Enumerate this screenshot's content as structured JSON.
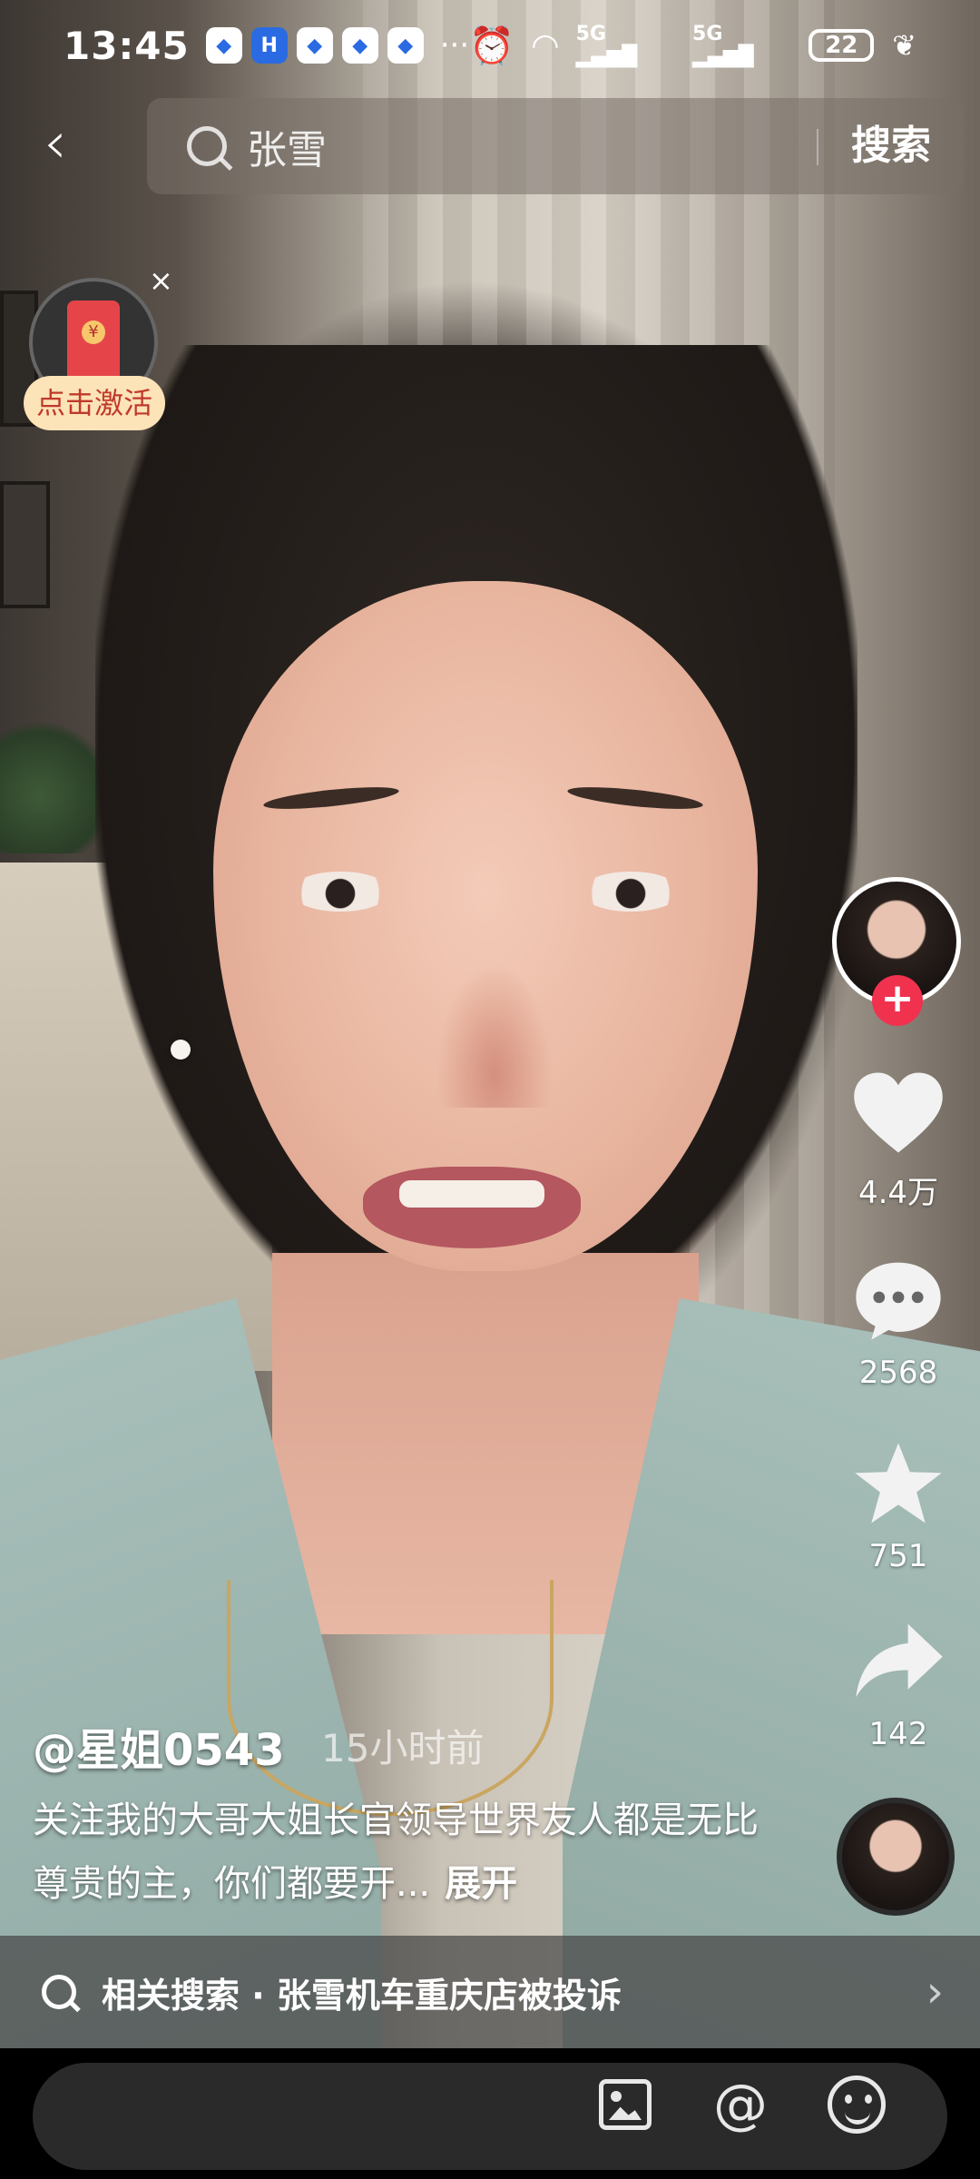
{
  "status_bar": {
    "time": "13:45",
    "notification_icons": [
      "app-icon",
      "h-app-icon",
      "app-icon",
      "app-icon",
      "app-icon"
    ],
    "more": "···",
    "network_1": "5G",
    "network_2": "5G",
    "battery": "22"
  },
  "search": {
    "query": "张雪",
    "button_label": "搜索"
  },
  "envelope": {
    "label": "点击激活",
    "close": "×"
  },
  "actions": {
    "likes": "4.4万",
    "comments": "2568",
    "favorites": "751",
    "shares": "142",
    "follow": "+"
  },
  "post": {
    "author": "@星姐0543",
    "time_ago": "15小时前",
    "caption": "关注我的大哥大姐长官领导世界友人都是无比尊贵的主，你们都要开...",
    "expand_label": "展开"
  },
  "related": {
    "text": "相关搜索 · 张雪机车重庆店被投诉"
  },
  "comment_bar": {
    "placeholder": "",
    "at_symbol": "@"
  }
}
